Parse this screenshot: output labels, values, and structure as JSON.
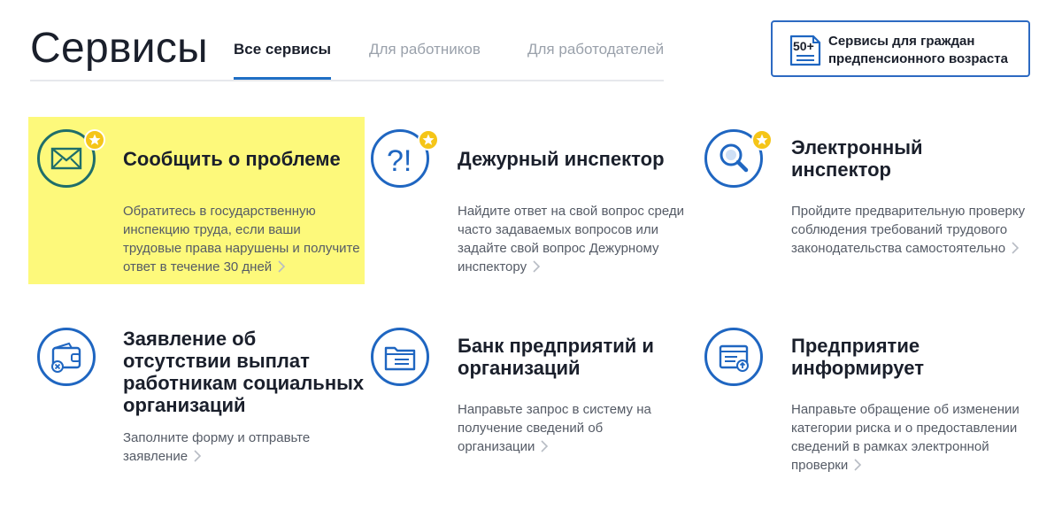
{
  "page": {
    "title": "Сервисы"
  },
  "tabs": [
    {
      "label": "Все сервисы",
      "active": true
    },
    {
      "label": "Для работников",
      "active": false
    },
    {
      "label": "Для работодателей",
      "active": false
    }
  ],
  "promo": {
    "badge": "50+",
    "text": "Сервисы для граждан предпенсионного возраста"
  },
  "services": [
    {
      "title": "Сообщить о проблеме",
      "desc": "Обратитесь в государственную инспекцию труда, если ваши трудовые права нарушены и получите ответ в течение 30 дней",
      "icon": "envelope-icon",
      "featured": true,
      "highlighted": true
    },
    {
      "title": "Дежурный инспектор",
      "desc": "Найдите ответ на свой вопрос среди часто задаваемых вопросов или задайте свой вопрос Дежурному инспектору",
      "icon": "question-exclamation-icon",
      "featured": true
    },
    {
      "title": "Электронный инспектор",
      "desc": "Пройдите предварительную проверку соблюдения требований трудового законодательства самостоятельно",
      "icon": "magnifier-icon",
      "featured": true
    },
    {
      "title": "Заявление об отсутствии выплат работникам социальных организаций",
      "desc": "Заполните форму и отправьте заявление",
      "icon": "wallet-icon",
      "featured": false
    },
    {
      "title": "Банк предприятий и организаций",
      "desc": "Направьте запрос в систему на получение сведений об организации",
      "icon": "folder-icon",
      "featured": false
    },
    {
      "title": "Предприятие информирует",
      "desc": "Направьте обращение об изменении категории риска и о предоставлении сведений в рамках электронной проверки",
      "icon": "document-upload-icon",
      "featured": false
    }
  ],
  "colors": {
    "accent": "#1f66c1",
    "green": "#1f6e6a",
    "star": "#f5c518",
    "highlight": "#fdf97b"
  }
}
